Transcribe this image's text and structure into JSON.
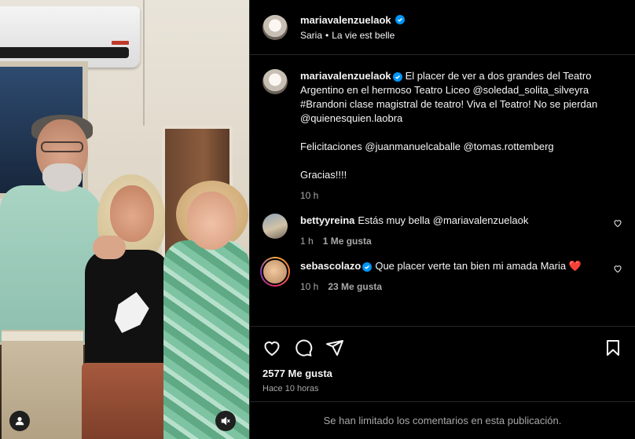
{
  "post": {
    "username": "mariavalenzuelaok",
    "subtitle_audio_artist": "Saria",
    "subtitle_audio_track": "La vie est belle",
    "caption_paragraphs": [
      "El placer de ver a dos grandes del Teatro Argentino en el hermoso Teatro Liceo @soledad_solita_silveyra #Brandoni clase magistral de teatro! Viva el Teatro! No se pierdan @quienesquien.laobra",
      "Felicitaciones @juanmanuelcaballe @tomas.rottemberg",
      "Gracias!!!!"
    ],
    "caption_time": "10 h",
    "likes_label": "2577 Me gusta",
    "time_ago": "Hace 10 horas",
    "comments_limited": "Se han limitado los comentarios en esta publicación."
  },
  "comments": [
    {
      "username": "bettyyreina",
      "text": "Estás muy bella @mariavalenzuelaok",
      "time": "1 h",
      "likes": "1 Me gusta"
    },
    {
      "username": "sebascolazo",
      "text": "Que placer verte tan bien mi amada Maria ❤️",
      "time": "10 h",
      "likes": "23 Me gusta"
    }
  ],
  "colors": {
    "verified": "#0095f6",
    "muted_text": "#a8a8a8",
    "heart": "#e0245e"
  },
  "icons": [
    "user-tag-icon",
    "mute-icon",
    "heart-icon",
    "comment-icon",
    "share-icon",
    "save-icon",
    "verified-icon"
  ]
}
